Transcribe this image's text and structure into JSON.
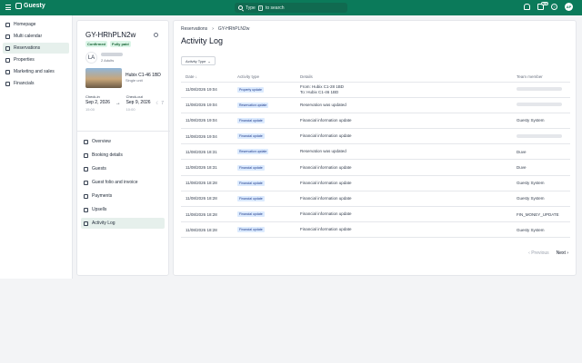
{
  "topbar": {
    "logo": "Guesty",
    "search_prefix": "Type",
    "search_key": "/",
    "search_suffix": "to search",
    "badge": "New",
    "user_initials": "AP"
  },
  "leftnav": {
    "items": [
      {
        "label": "Homepage",
        "icon": "home-icon"
      },
      {
        "label": "Multi calendar",
        "icon": "calendar-icon"
      },
      {
        "label": "Reservations",
        "icon": "reservations-icon"
      },
      {
        "label": "Properties",
        "icon": "properties-icon"
      },
      {
        "label": "Marketing and sales",
        "icon": "marketing-icon"
      },
      {
        "label": "Financials",
        "icon": "financials-icon"
      }
    ]
  },
  "reservation": {
    "code": "GY-HRhPLN2w",
    "tags": [
      "Confirmed",
      "Fully paid"
    ],
    "guest_initials": "LA",
    "adults": "2 Adults",
    "property_name": "Hubix C1-46 1BD",
    "property_unit": "Single unit",
    "checkin_label": "Check-in",
    "checkin_date": "Sep 2, 2026",
    "checkin_time": "15:00",
    "checkout_label": "Check-out",
    "checkout_date": "Sep 9, 2026",
    "checkout_time": "10:00",
    "nights": "7",
    "menu": [
      {
        "label": "Overview",
        "icon": "overview-icon"
      },
      {
        "label": "Booking details",
        "icon": "booking-icon"
      },
      {
        "label": "Guests",
        "icon": "guests-icon"
      },
      {
        "label": "Guest folio and invoice",
        "icon": "invoice-icon"
      },
      {
        "label": "Payments",
        "icon": "payments-icon"
      },
      {
        "label": "Upsells",
        "icon": "upsells-icon"
      },
      {
        "label": "Activity Log",
        "icon": "activity-icon"
      }
    ]
  },
  "main": {
    "breadcrumb": [
      "Reservations",
      "GY-HRhPLN2w"
    ],
    "title": "Activity Log",
    "filter_label": "Activity Type",
    "columns": [
      "Date",
      "Activity type",
      "Details",
      "Team member"
    ],
    "rows": [
      {
        "date": "11/08/2026 19:04",
        "type": "Property update",
        "details": [
          "From: Hubix C1-28 1BD",
          "To: Hubix C1-46 1BD"
        ],
        "member": ""
      },
      {
        "date": "11/08/2026 19:04",
        "type": "Reservation update",
        "details": [
          "Reservation was updated"
        ],
        "member": ""
      },
      {
        "date": "11/08/2026 19:04",
        "type": "Financial update",
        "details": [
          "Financial information update"
        ],
        "member": "Guesty System"
      },
      {
        "date": "11/08/2026 19:04",
        "type": "Financial update",
        "details": [
          "Financial information update"
        ],
        "member": ""
      },
      {
        "date": "11/08/2026 18:31",
        "type": "Reservation update",
        "details": [
          "Reservation was updated"
        ],
        "member": "Duve"
      },
      {
        "date": "11/08/2026 18:31",
        "type": "Financial update",
        "details": [
          "Financial information update"
        ],
        "member": "Duve"
      },
      {
        "date": "11/08/2026 18:28",
        "type": "Financial update",
        "details": [
          "Financial information update"
        ],
        "member": "Guesty System"
      },
      {
        "date": "11/08/2026 18:28",
        "type": "Financial update",
        "details": [
          "Financial information update"
        ],
        "member": "Guesty System"
      },
      {
        "date": "11/08/2026 18:28",
        "type": "Financial update",
        "details": [
          "Financial information update"
        ],
        "member": "FIN_MONEY_UPDATE"
      },
      {
        "date": "11/08/2026 18:28",
        "type": "Financial update",
        "details": [
          "Financial information update"
        ],
        "member": "Guesty System"
      }
    ],
    "pagination": {
      "prev": "Previous",
      "next": "Next"
    }
  }
}
